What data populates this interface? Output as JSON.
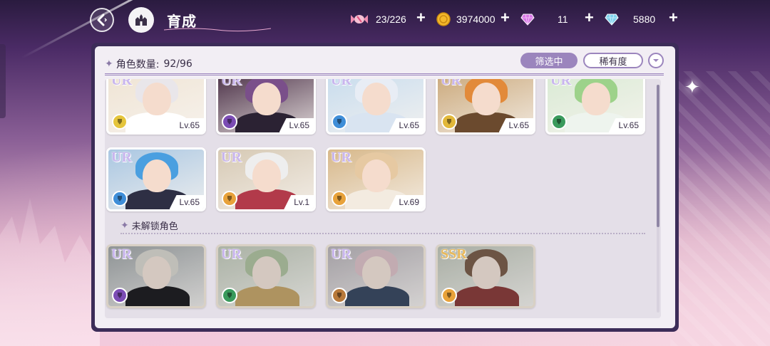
{
  "header": {
    "title": "育成",
    "resources": [
      {
        "icon": "candy-icon",
        "value": "23/226"
      },
      {
        "icon": "gold-coin-icon",
        "value": "3974000"
      },
      {
        "icon": "pink-gem-icon",
        "value": "11"
      },
      {
        "icon": "blue-diamond-icon",
        "value": "5880"
      }
    ]
  },
  "panel": {
    "count_label": "角色数量:",
    "count_value": "92/96",
    "filter_label": "筛选中",
    "sort_label": "稀有度",
    "locked_section_label": "未解锁角色"
  },
  "owned_characters": [
    {
      "rarity": "UR",
      "level": "Lv.65",
      "attr_color": "#e5c53c",
      "hair": "#e9e6ea",
      "bg": "#efe4d4",
      "body": "#ffffff"
    },
    {
      "rarity": "UR",
      "level": "Lv.65",
      "attr_color": "#7b4cb4",
      "hair": "#7a4f8a",
      "bg": "#4a2f46",
      "body": "#2b2233"
    },
    {
      "rarity": "UR",
      "level": "Lv.65",
      "attr_color": "#3f8ed8",
      "hair": "#e8edf5",
      "bg": "#c7dcee",
      "body": "#d9e4f1"
    },
    {
      "rarity": "UR",
      "level": "Lv.65",
      "attr_color": "#e2b83a",
      "hair": "#e28a3a",
      "bg": "#caa87a",
      "body": "#6b4a2e"
    },
    {
      "rarity": "UR",
      "level": "Lv.65",
      "attr_color": "#3a9a5c",
      "hair": "#9dd28a",
      "bg": "#d9ead4",
      "body": "#eef4ee"
    },
    {
      "rarity": "UR",
      "level": "Lv.65",
      "attr_color": "#3f8ed8",
      "hair": "#4a9fe0",
      "bg": "#aac7e2",
      "body": "#2e2f44"
    },
    {
      "rarity": "UR",
      "level": "Lv.1",
      "attr_color": "#e8a23a",
      "hair": "#eeeeee",
      "bg": "#d6c9b4",
      "body": "#b23a4a"
    },
    {
      "rarity": "UR",
      "level": "Lv.69",
      "attr_color": "#e8a23a",
      "hair": "#e6c9a2",
      "bg": "#d7b88a",
      "body": "#f3ebe0"
    }
  ],
  "locked_characters": [
    {
      "rarity": "UR",
      "attr_color": "#7b4cb4",
      "hair": "#d6d3c8",
      "bg": "#9aa4a8",
      "body": "#1f1f26"
    },
    {
      "rarity": "UR",
      "attr_color": "#3a9a5c",
      "hair": "#a2c48a",
      "bg": "#b9c8ae",
      "body": "#d7a23a"
    },
    {
      "rarity": "UR",
      "attr_color": "#b8793a",
      "hair": "#e8b9c6",
      "bg": "#b8b0ba",
      "body": "#2f4a78"
    },
    {
      "rarity": "SSR",
      "attr_color": "#e8a23a",
      "hair": "#8a5a3a",
      "bg": "#b9c4b0",
      "body": "#b6302e"
    }
  ]
}
